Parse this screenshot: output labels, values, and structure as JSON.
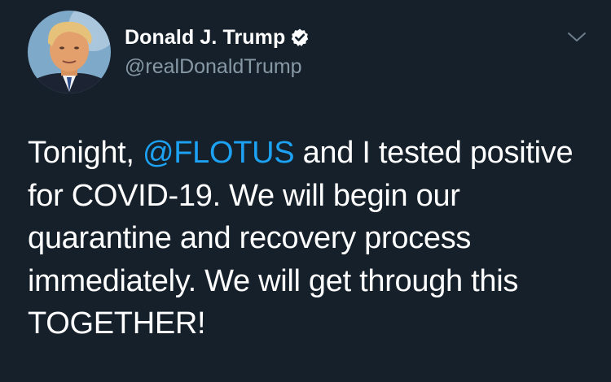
{
  "user": {
    "display_name": "Donald J. Trump",
    "handle": "@realDonaldTrump",
    "verified": true
  },
  "icons": {
    "verified": "verified-badge-icon",
    "menu": "chevron-down-icon"
  },
  "tweet": {
    "text_before_mention": "Tonight, ",
    "mention": "@FLOTUS",
    "text_after_mention": " and I tested positive for COVID-19. We will begin our quarantine and recovery process immediately. We will get through this TOGETHER!"
  },
  "colors": {
    "background": "#15202b",
    "text": "#ffffff",
    "secondary_text": "#8899a6",
    "accent": "#1da1f2"
  }
}
